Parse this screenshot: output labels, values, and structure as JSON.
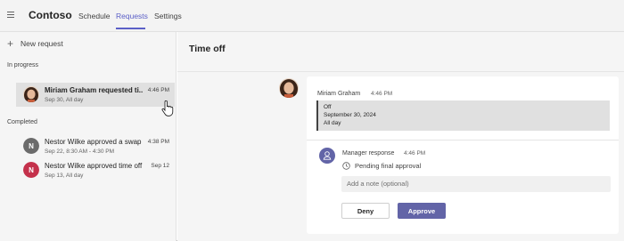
{
  "app": {
    "name": "Contoso"
  },
  "tabs": [
    {
      "label": "Schedule"
    },
    {
      "label": "Requests"
    },
    {
      "label": "Settings"
    }
  ],
  "sidebar": {
    "new_request": "New request",
    "sections": [
      {
        "title": "In progress"
      },
      {
        "title": "Completed"
      }
    ],
    "items": [
      {
        "title": "Miriam Graham requested ti...",
        "time": "4:46 PM",
        "subtitle": "Sep 30, All day"
      },
      {
        "title": "Nestor Wilke approved a swap",
        "time": "4:38 PM",
        "subtitle": "Sep 22, 8:30 AM - 4:30 PM",
        "initial": "N",
        "color": "#6b6b6b"
      },
      {
        "title": "Nestor Wilke approved time off",
        "time": "Sep 12",
        "subtitle": "Sep 13, All day",
        "initial": "N",
        "color": "#c4314b"
      }
    ]
  },
  "main": {
    "title": "Time off",
    "message": {
      "sender": "Miriam Graham",
      "time": "4:46 PM",
      "quote": {
        "line1": "Off",
        "line2": "September 30, 2024",
        "line3": "All day"
      }
    },
    "manager": {
      "label": "Manager response",
      "time": "4:46 PM",
      "status": "Pending final approval",
      "note_placeholder": "Add a note (optional)",
      "deny": "Deny",
      "approve": "Approve"
    }
  },
  "colors": {
    "accent": "#5b5fc7",
    "approve": "#6264a7"
  }
}
